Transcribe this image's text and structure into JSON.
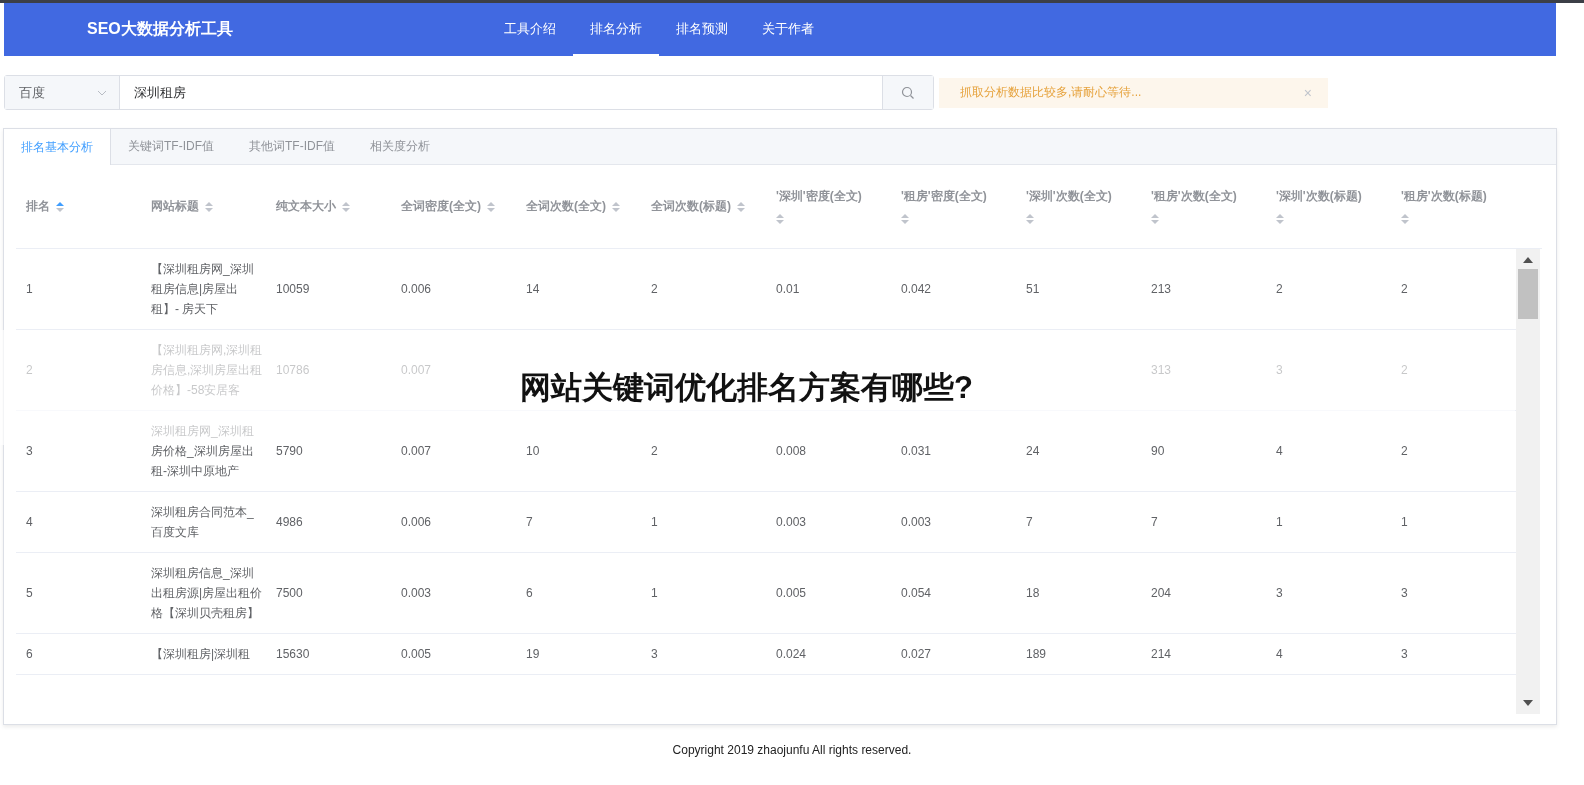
{
  "header": {
    "brand": "SEO大数据分析工具",
    "nav": [
      {
        "label": "工具介绍",
        "selected": false
      },
      {
        "label": "排名分析",
        "selected": true
      },
      {
        "label": "排名预测",
        "selected": false
      },
      {
        "label": "关于作者",
        "selected": false
      }
    ]
  },
  "search": {
    "engine": "百度",
    "value": "深圳租房"
  },
  "alert": {
    "text": "抓取分析数据比较多,请耐心等待...",
    "close": "×"
  },
  "tabs": [
    {
      "label": "排名基本分析",
      "selected": true
    },
    {
      "label": "关键词TF-IDF值",
      "selected": false
    },
    {
      "label": "其他词TF-IDF值",
      "selected": false
    },
    {
      "label": "相关度分析",
      "selected": false
    }
  ],
  "table": {
    "columns": [
      {
        "label": "排名",
        "sorted": true
      },
      {
        "label": "网站标题",
        "sorted": false
      },
      {
        "label": "纯文本大小",
        "sorted": false
      },
      {
        "label": "全词密度(全文)",
        "sorted": false
      },
      {
        "label": "全词次数(全文)",
        "sorted": false
      },
      {
        "label": "全词次数(标题)",
        "sorted": false
      },
      {
        "label": "'深圳'密度(全文)",
        "sorted": false
      },
      {
        "label": "'租房'密度(全文)",
        "sorted": false
      },
      {
        "label": "'深圳'次数(全文)",
        "sorted": false
      },
      {
        "label": "'租房'次数(全文)",
        "sorted": false
      },
      {
        "label": "'深圳'次数(标题)",
        "sorted": false
      },
      {
        "label": "'租房'次数(标题)",
        "sorted": false
      }
    ],
    "rows": [
      {
        "cells": [
          "1",
          "【深圳租房网_深圳租房信息|房屋出租】- 房天下",
          "10059",
          "0.006",
          "14",
          "2",
          "0.01",
          "0.042",
          "51",
          "213",
          "2",
          "2"
        ]
      },
      {
        "cells": [
          "2",
          "【深圳租房网,深圳租房信息,深圳房屋出租价格】-58安居客",
          "10786",
          "0.007",
          null,
          null,
          null,
          null,
          null,
          "313",
          "3",
          "2"
        ]
      },
      {
        "cells": [
          "3",
          "深圳租房网_深圳租房价格_深圳房屋出租-深圳中原地产",
          "5790",
          "0.007",
          "10",
          "2",
          "0.008",
          "0.031",
          "24",
          "90",
          "4",
          "2"
        ]
      },
      {
        "cells": [
          "4",
          "深圳租房合同范本_百度文库",
          "4986",
          "0.006",
          "7",
          "1",
          "0.003",
          "0.003",
          "7",
          "7",
          "1",
          "1"
        ]
      },
      {
        "cells": [
          "5",
          "深圳租房信息_深圳出租房源|房屋出租价格【深圳贝壳租房】",
          "7500",
          "0.003",
          "6",
          "1",
          "0.005",
          "0.054",
          "18",
          "204",
          "3",
          "3"
        ]
      },
      {
        "cells": [
          "6",
          "【深圳租房|深圳租",
          "15630",
          "0.005",
          "19",
          "3",
          "0.024",
          "0.027",
          "189",
          "214",
          "4",
          "3"
        ]
      }
    ]
  },
  "overlay_title": "网站关键词优化排名方案有哪些?",
  "footer": "Copyright 2019 zhaojunfu All rights reserved."
}
